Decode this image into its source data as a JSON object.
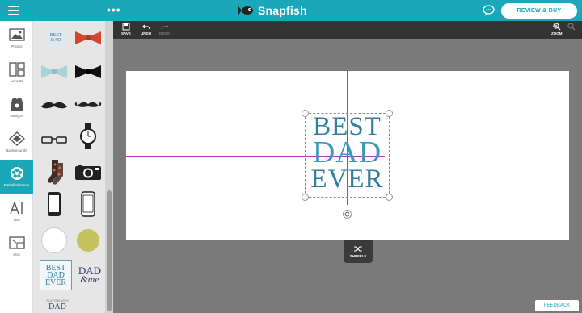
{
  "header": {
    "logo_text": "Snapfish",
    "review_button": "REVIEW & BUY",
    "colors": {
      "brand": "#1aa7b9",
      "toolbar": "#333333",
      "guide": "#b03ab4"
    }
  },
  "toolbar": {
    "save": "SAVE",
    "undo": "UNDO",
    "redo": "REDO",
    "zoom": "ZOOM"
  },
  "sidebar": {
    "items": [
      {
        "label": "Photos",
        "icon": "photos-icon"
      },
      {
        "label": "Layouts",
        "icon": "layouts-icon"
      },
      {
        "label": "Designs",
        "icon": "designs-icon"
      },
      {
        "label": "Backgrounds",
        "icon": "backgrounds-icon"
      },
      {
        "label": "Embellishments",
        "icon": "embellishments-icon",
        "active": true
      },
      {
        "label": "Text",
        "icon": "text-icon"
      },
      {
        "label": "Size",
        "icon": "size-icon"
      }
    ]
  },
  "stickers": {
    "best_dad_small": "BEST DAD",
    "dad_and_me_1": "DAD",
    "dad_and_me_2": "&me",
    "best_dad_ever": [
      "BEST",
      "DAD",
      "EVER"
    ],
    "bottom_small": "PLAYTIME WITH",
    "bottom_dad": "DAD"
  },
  "canvas": {
    "design_text": [
      "BEST",
      "DAD",
      "EVER"
    ]
  },
  "shuffle_label": "SHUFFLE",
  "feedback_label": "FEEDBACK"
}
